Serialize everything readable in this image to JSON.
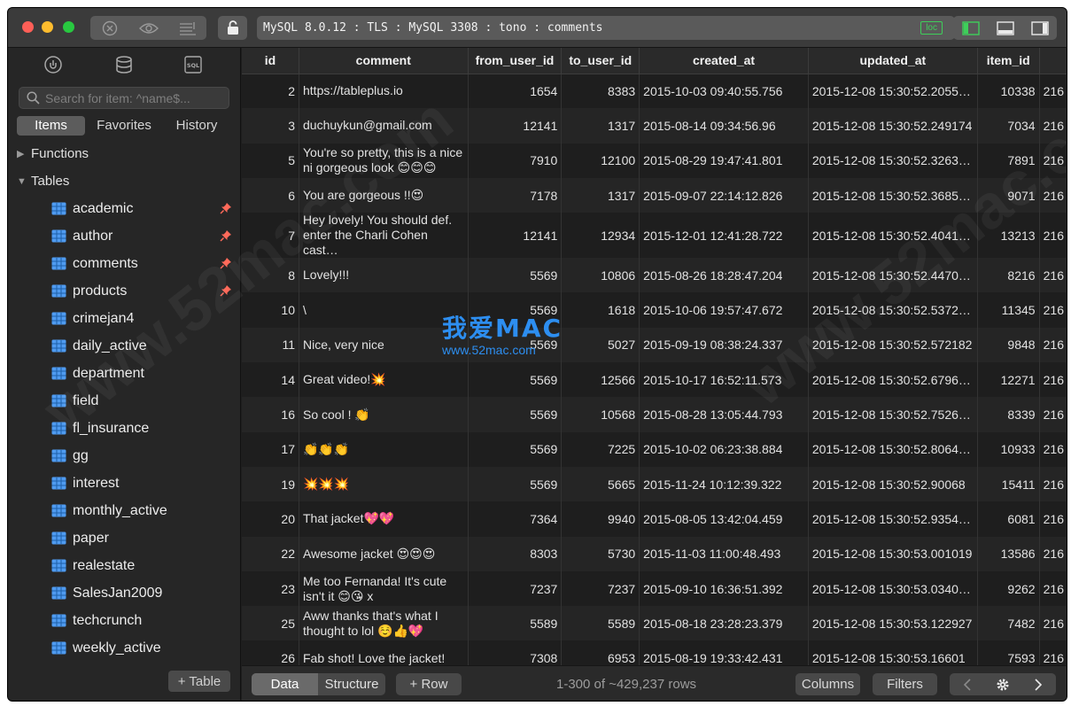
{
  "titlebar": {
    "connection": "MySQL 8.0.12 : TLS : MySQL 3308 : tono : comments",
    "badge": "loc"
  },
  "sidebar": {
    "search_placeholder": "Search for item: ^name$...",
    "tabs": [
      "Items",
      "Favorites",
      "History"
    ],
    "functions_label": "Functions",
    "tables_label": "Tables",
    "tables": [
      {
        "label": "academic",
        "pinned": true
      },
      {
        "label": "author",
        "pinned": true
      },
      {
        "label": "comments",
        "pinned": true
      },
      {
        "label": "products",
        "pinned": true
      },
      {
        "label": "crimejan4",
        "pinned": false
      },
      {
        "label": "daily_active",
        "pinned": false
      },
      {
        "label": "department",
        "pinned": false
      },
      {
        "label": "field",
        "pinned": false
      },
      {
        "label": "fl_insurance",
        "pinned": false
      },
      {
        "label": "gg",
        "pinned": false
      },
      {
        "label": "interest",
        "pinned": false
      },
      {
        "label": "monthly_active",
        "pinned": false
      },
      {
        "label": "paper",
        "pinned": false
      },
      {
        "label": "realestate",
        "pinned": false
      },
      {
        "label": "SalesJan2009",
        "pinned": false
      },
      {
        "label": "techcrunch",
        "pinned": false
      },
      {
        "label": "weekly_active",
        "pinned": false
      }
    ],
    "add_table_label": "+ Table"
  },
  "grid": {
    "columns": [
      "id",
      "comment",
      "from_user_id",
      "to_user_id",
      "created_at",
      "updated_at",
      "item_id",
      ""
    ],
    "rows": [
      [
        "2",
        "https://tableplus.io",
        "1654",
        "8383",
        "2015-10-03 09:40:55.756",
        "2015-12-08 15:30:52.2055…",
        "10338",
        "216"
      ],
      [
        "3",
        "duchuykun@gmail.com",
        "12141",
        "1317",
        "2015-08-14 09:34:56.96",
        "2015-12-08 15:30:52.249174",
        "7034",
        "216"
      ],
      [
        "5",
        "You're so pretty, this is a nice ni gorgeous look 😊😊😊",
        "7910",
        "12100",
        "2015-08-29 19:47:41.801",
        "2015-12-08 15:30:52.3263…",
        "7891",
        "216"
      ],
      [
        "6",
        "You are gorgeous !!😍",
        "7178",
        "1317",
        "2015-09-07 22:14:12.826",
        "2015-12-08 15:30:52.3685…",
        "9071",
        "216"
      ],
      [
        "7",
        "Hey lovely! You should def. enter the Charli Cohen cast…",
        "12141",
        "12934",
        "2015-12-01 12:41:28.722",
        "2015-12-08 15:30:52.4041…",
        "13213",
        "216"
      ],
      [
        "8",
        "Lovely!!!",
        "5569",
        "10806",
        "2015-08-26 18:28:47.204",
        "2015-12-08 15:30:52.4470…",
        "8216",
        "216"
      ],
      [
        "10",
        "\\",
        "5569",
        "1618",
        "2015-10-06 19:57:47.672",
        "2015-12-08 15:30:52.5372…",
        "11345",
        "216"
      ],
      [
        "11",
        "Nice, very nice",
        "5569",
        "5027",
        "2015-09-19 08:38:24.337",
        "2015-12-08 15:30:52.572182",
        "9848",
        "216"
      ],
      [
        "14",
        "Great video!💥",
        "5569",
        "12566",
        "2015-10-17 16:52:11.573",
        "2015-12-08 15:30:52.6796…",
        "12271",
        "216"
      ],
      [
        "16",
        "So cool ! 👏",
        "5569",
        "10568",
        "2015-08-28 13:05:44.793",
        "2015-12-08 15:30:52.7526…",
        "8339",
        "216"
      ],
      [
        "17",
        "👏👏👏",
        "5569",
        "7225",
        "2015-10-02 06:23:38.884",
        "2015-12-08 15:30:52.8064…",
        "10933",
        "216"
      ],
      [
        "19",
        "💥💥💥",
        "5569",
        "5665",
        "2015-11-24 10:12:39.322",
        "2015-12-08 15:30:52.90068",
        "15411",
        "216"
      ],
      [
        "20",
        "That jacket💖💖",
        "7364",
        "9940",
        "2015-08-05 13:42:04.459",
        "2015-12-08 15:30:52.9354…",
        "6081",
        "216"
      ],
      [
        "22",
        "Awesome jacket 😍😍😍",
        "8303",
        "5730",
        "2015-11-03 11:00:48.493",
        "2015-12-08 15:30:53.001019",
        "13586",
        "216"
      ],
      [
        "23",
        "Me too Fernanda! It's cute isn't it 😊😘 x",
        "7237",
        "7237",
        "2015-09-10 16:36:51.392",
        "2015-12-08 15:30:53.0340…",
        "9262",
        "216"
      ],
      [
        "25",
        "Aww thanks that's what I thought to lol ☺️👍💖",
        "5589",
        "5589",
        "2015-08-18 23:28:23.379",
        "2015-12-08 15:30:53.122927",
        "7482",
        "216"
      ],
      [
        "26",
        "Fab shot! Love the jacket!",
        "7308",
        "6953",
        "2015-08-19 19:33:42.431",
        "2015-12-08 15:30:53.16601",
        "7593",
        "216"
      ]
    ]
  },
  "footer": {
    "data_label": "Data",
    "structure_label": "Structure",
    "add_row_label": "+ Row",
    "rows_info": "1-300 of ~429,237 rows",
    "columns_label": "Columns",
    "filters_label": "Filters"
  },
  "watermark": {
    "text": "www.52mac.com",
    "logo_cn": "我爱MAC",
    "logo_url": "www.52mac.com"
  },
  "colors": {
    "window_bg": "#1e1e1e",
    "sidebar_bg": "#262626",
    "table_icon": "#4f9bf0",
    "pin": "#ff6a5a",
    "loc_badge": "#3ecf5a"
  }
}
